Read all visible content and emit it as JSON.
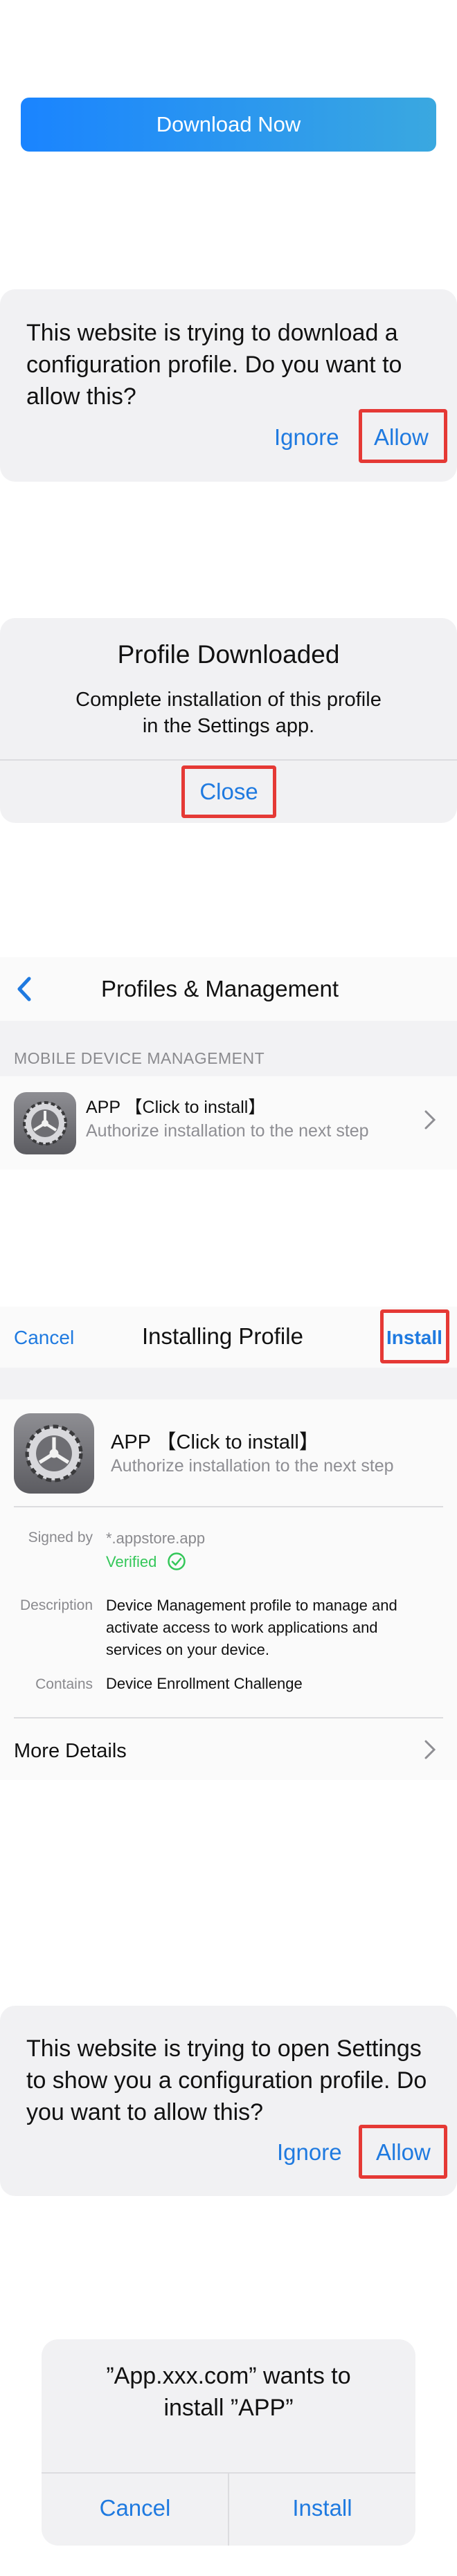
{
  "download": {
    "label": "Download Now"
  },
  "alert1": {
    "message": "This website is trying to download a configuration profile. Do you want to allow this?",
    "ignore_label": "Ignore",
    "allow_label": "Allow"
  },
  "profile_downloaded": {
    "title": "Profile Downloaded",
    "message_line1": "Complete installation of this profile",
    "message_line2": "in the Settings app.",
    "close_label": "Close"
  },
  "profiles": {
    "title": "Profiles & Management",
    "section_header": "MOBILE DEVICE MANAGEMENT",
    "item_name": "APP 【Click to install】",
    "item_subtitle": "Authorize installation to the next step"
  },
  "installing": {
    "cancel_label": "Cancel",
    "title": "Installing Profile",
    "install_label": "Install",
    "app_name": "APP 【Click to install】",
    "app_subtitle": "Authorize installation to the next step",
    "signed_by_label": "Signed by",
    "signed_by_value": "*.appstore.app",
    "verified_label": "Verified",
    "description_label": "Description",
    "description_value": "Device Management profile to manage and activate access to work applications and services on your device.",
    "contains_label": "Contains",
    "contains_value": "Device Enrollment Challenge",
    "more_details_label": "More Details"
  },
  "alert2": {
    "message": "This website is trying to open Settings to show you a configuration profile. Do you want to allow this?",
    "ignore_label": "Ignore",
    "allow_label": "Allow"
  },
  "final_dialog": {
    "line1": "”App.xxx.com” wants to",
    "line2": "install ”APP”",
    "cancel_label": "Cancel",
    "install_label": "Install"
  },
  "colors": {
    "accent_blue": "#1f7ae0",
    "highlight_red": "#e53935",
    "verified_green": "#34c759"
  }
}
